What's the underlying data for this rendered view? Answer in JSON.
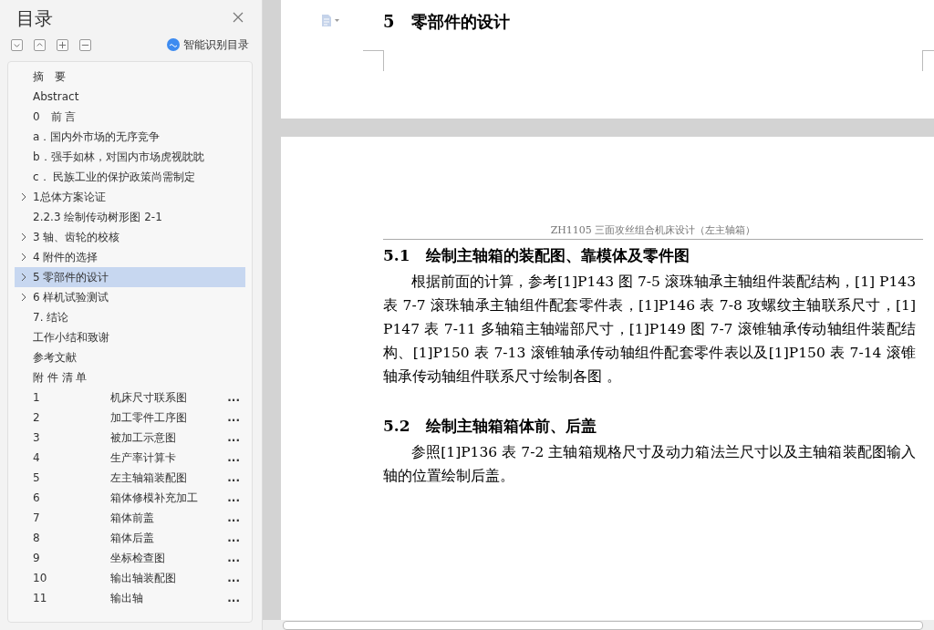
{
  "sidebar": {
    "title": "目录",
    "smart_button": "智能识别目录",
    "items": [
      {
        "kind": "leaf",
        "label": "摘　要",
        "selected": false
      },
      {
        "kind": "leaf",
        "label": "Abstract",
        "selected": false
      },
      {
        "kind": "leaf",
        "label": "0　前 言",
        "selected": false
      },
      {
        "kind": "leaf",
        "label": "a．国内外市场的无序竞争",
        "selected": false
      },
      {
        "kind": "leaf",
        "label": "b．强手如林，对国内市场虎视眈眈",
        "selected": false
      },
      {
        "kind": "leaf",
        "label": "c． 民族工业的保护政策尚需制定",
        "selected": false
      },
      {
        "kind": "branch",
        "label": "1总体方案论证",
        "selected": false
      },
      {
        "kind": "leaf",
        "label": "2.2.3  绘制传动树形图 2-1",
        "selected": false
      },
      {
        "kind": "branch",
        "label": "3  轴、齿轮的校核",
        "selected": false
      },
      {
        "kind": "branch",
        "label": "4  附件的选择",
        "selected": false
      },
      {
        "kind": "branch",
        "label": "5  零部件的设计",
        "selected": true
      },
      {
        "kind": "branch",
        "label": "6  样机试验测试",
        "selected": false
      },
      {
        "kind": "leaf",
        "label": "7. 结论",
        "selected": false
      },
      {
        "kind": "leaf",
        "label": "工作小结和致谢",
        "selected": false
      },
      {
        "kind": "leaf",
        "label": "参考文献",
        "selected": false
      },
      {
        "kind": "leaf",
        "label": "附 件 清 单",
        "selected": false
      },
      {
        "kind": "appendix",
        "number": "1",
        "label": "机床尺寸联系图",
        "dots": "...",
        "selected": false
      },
      {
        "kind": "appendix",
        "number": "2",
        "label": "加工零件工序图",
        "dots": "...",
        "selected": false
      },
      {
        "kind": "appendix",
        "number": "3",
        "label": "被加工示意图",
        "dots": "...",
        "selected": false
      },
      {
        "kind": "appendix",
        "number": "4",
        "label": "生产率计算卡",
        "dots": "...",
        "selected": false
      },
      {
        "kind": "appendix",
        "number": "5",
        "label": "左主轴箱装配图",
        "dots": "...",
        "selected": false
      },
      {
        "kind": "appendix",
        "number": "6",
        "label": "箱体修模补充加工",
        "dots": "...",
        "selected": false
      },
      {
        "kind": "appendix",
        "number": "7",
        "label": "箱体前盖",
        "dots": "...",
        "selected": false
      },
      {
        "kind": "appendix",
        "number": "8",
        "label": "箱体后盖",
        "dots": "...",
        "selected": false
      },
      {
        "kind": "appendix",
        "number": "9",
        "label": "坐标检查图",
        "dots": "...",
        "selected": false
      },
      {
        "kind": "appendix",
        "number": "10",
        "label": "输出轴装配图",
        "dots": "...",
        "selected": false
      },
      {
        "kind": "appendix",
        "number": "11",
        "label": "输出轴",
        "dots": "...",
        "selected": false
      }
    ]
  },
  "document": {
    "page1_heading": "5　零部件的设计",
    "page2_header": "ZH1105 三面攻丝组合机床设计（左主轴箱）",
    "sections": [
      {
        "heading": "5.1　绘制主轴箱的装配图、靠模体及零件图",
        "body": "根据前面的计算，参考[1]P143 图 7-5 滚珠轴承主轴组件装配结构，[1] P143 表 7-7 滚珠轴承主轴组件配套零件表，[1]P146 表 7-8 攻螺纹主轴联系尺寸，[1] P147 表 7-11 多轴箱主轴端部尺寸，[1]P149 图 7-7 滚锥轴承传动轴组件装配结构、[1]P150 表 7-13 滚锥轴承传动轴组件配套零件表以及[1]P150 表 7-14 滚锥轴承传动轴组件联系尺寸绘制各图 。"
      },
      {
        "heading": "5.2　绘制主轴箱箱体前、后盖",
        "body": "参照[1]P136 表 7-2 主轴箱规格尺寸及动力箱法兰尺寸以及主轴箱装配图输入轴的位置绘制后盖。"
      }
    ]
  }
}
